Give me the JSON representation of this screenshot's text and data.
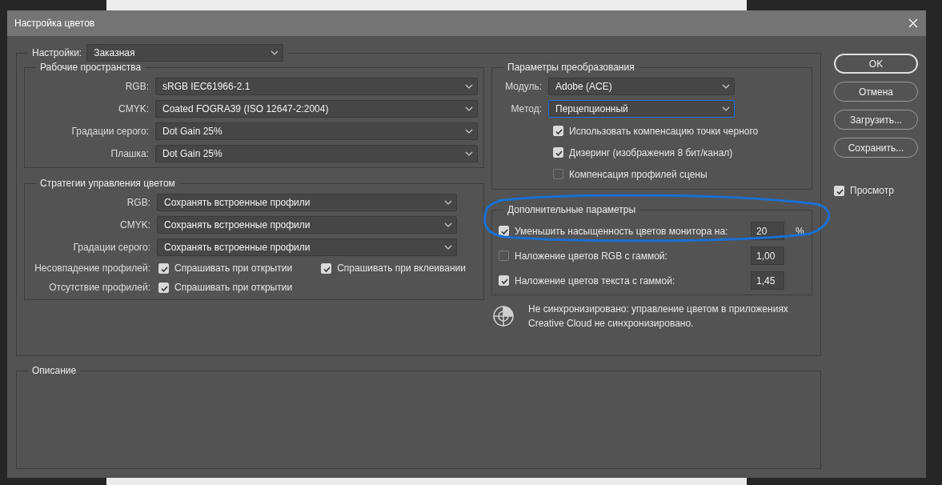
{
  "window": {
    "title": "Настройка цветов"
  },
  "settings": {
    "label": "Настройки:",
    "value": "Заказная"
  },
  "working_spaces": {
    "title": "Рабочие пространства",
    "rows": [
      {
        "label": "RGB:",
        "value": "sRGB IEC61966-2.1"
      },
      {
        "label": "CMYK:",
        "value": "Coated FOGRA39 (ISO 12647-2:2004)"
      },
      {
        "label": "Градации серого:",
        "value": "Dot Gain 25%"
      },
      {
        "label": "Плашка:",
        "value": "Dot Gain 25%"
      }
    ]
  },
  "policies": {
    "title": "Стратегии управления цветом",
    "rows": [
      {
        "label": "RGB:",
        "value": "Сохранять встроенные профили"
      },
      {
        "label": "CMYK:",
        "value": "Сохранять встроенные профили"
      },
      {
        "label": "Градации серого:",
        "value": "Сохранять встроенные профили"
      }
    ],
    "checks": [
      {
        "label": "Несовпадение профилей:",
        "options": [
          {
            "label": "Спрашивать при открытии",
            "checked": true
          },
          {
            "label": "Спрашивать при вклеивании",
            "checked": true
          }
        ]
      },
      {
        "label": "Отсутствие профилей:",
        "options": [
          {
            "label": "Спрашивать при открытии",
            "checked": true
          }
        ]
      }
    ]
  },
  "conversion": {
    "title": "Параметры преобразования",
    "rows": [
      {
        "label": "Модуль:",
        "value": "Adobe (ACE)",
        "focused": false
      },
      {
        "label": "Метод:",
        "value": "Перцепционный",
        "focused": true
      }
    ],
    "options": [
      {
        "label": "Использовать компенсацию точки черного",
        "checked": true
      },
      {
        "label": "Дизеринг (изображения 8 бит/канал)",
        "checked": true
      },
      {
        "label": "Компенсация профилей сцены",
        "checked": false
      }
    ]
  },
  "advanced": {
    "title": "Дополнительные параметры",
    "highlighted": true,
    "rows": [
      {
        "label": "Уменьшить насыщенность цветов монитора на:",
        "checked": true,
        "value": "20",
        "unit": "%"
      },
      {
        "label": "Наложение цветов RGB с гаммой:",
        "checked": false,
        "value": "1,00"
      },
      {
        "label": "Наложение цветов текста с гаммой:",
        "checked": true,
        "value": "1,45"
      }
    ]
  },
  "sync_note": {
    "lines": [
      "Не синхронизировано: управление цветом в приложениях",
      "Creative Cloud не синхронизировано."
    ]
  },
  "description": {
    "title": "Описание"
  },
  "buttons": [
    {
      "label": "OK",
      "primary": true
    },
    {
      "label": "Отмена",
      "primary": false
    },
    {
      "label": "Загрузить...",
      "primary": false
    },
    {
      "label": "Сохранить...",
      "primary": false
    }
  ],
  "preview": {
    "label": "Просмотр",
    "checked": true
  }
}
